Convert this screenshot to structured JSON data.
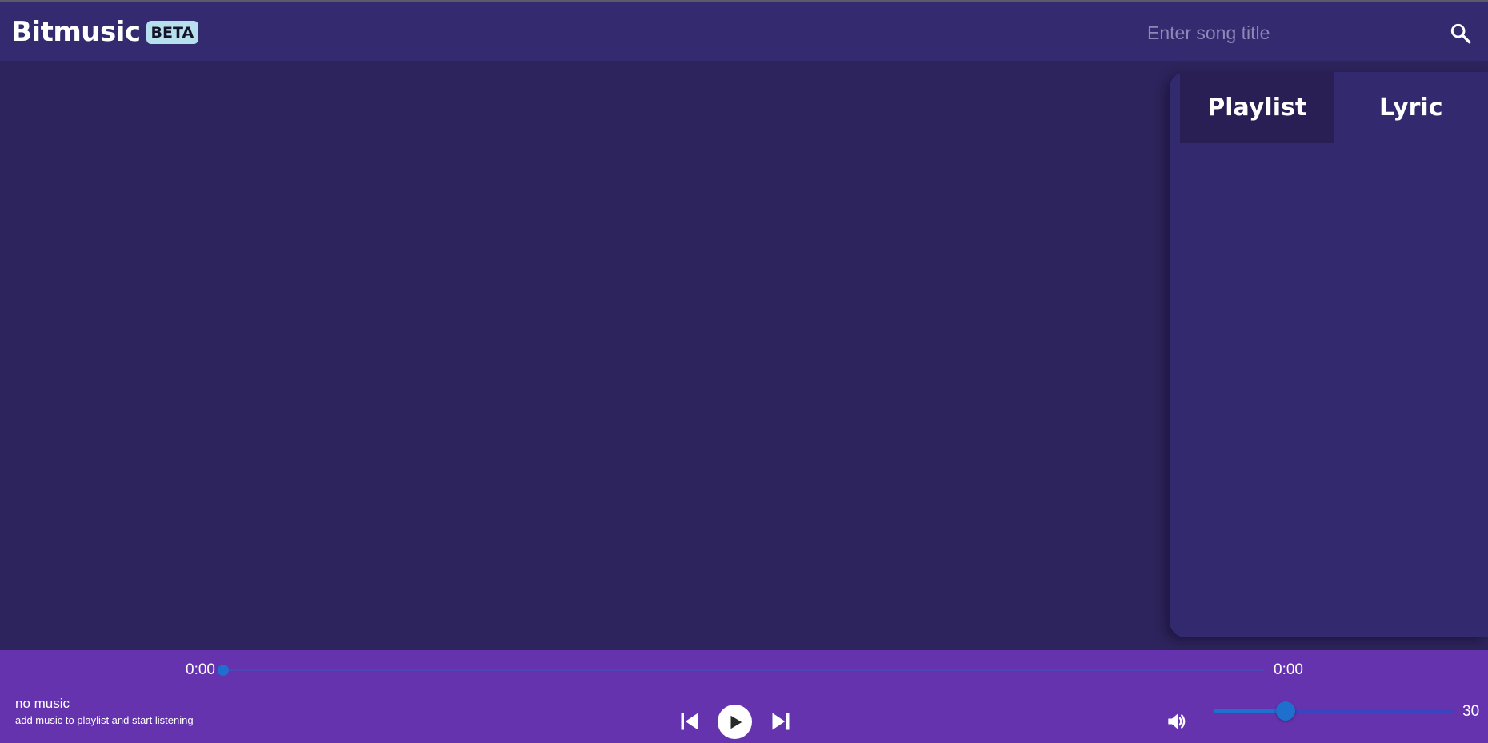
{
  "app": {
    "name": "Bitmusic",
    "badge": "BETA"
  },
  "search": {
    "placeholder": "Enter song title",
    "value": "",
    "icon": "search-icon"
  },
  "side_panel": {
    "tabs": [
      {
        "label": "Playlist",
        "active": true
      },
      {
        "label": "Lyric",
        "active": false
      }
    ]
  },
  "player": {
    "current_time": "0:00",
    "total_time": "0:00",
    "progress_fraction": 0,
    "song_title": "no music",
    "song_subtitle": "add music to playlist and start listening",
    "volume": 30,
    "volume_max": 100,
    "icons": {
      "prev": "skip-previous-icon",
      "play": "play-icon",
      "next": "skip-next-icon",
      "volume": "volume-up-icon"
    }
  },
  "colors": {
    "background": "#2e245d",
    "header": "#332a70",
    "panel": "#33296e",
    "active_tab": "#2a1f55",
    "player_bar": "#6633af",
    "accent": "#1f6fcf",
    "badge": "#b7e0ee"
  }
}
